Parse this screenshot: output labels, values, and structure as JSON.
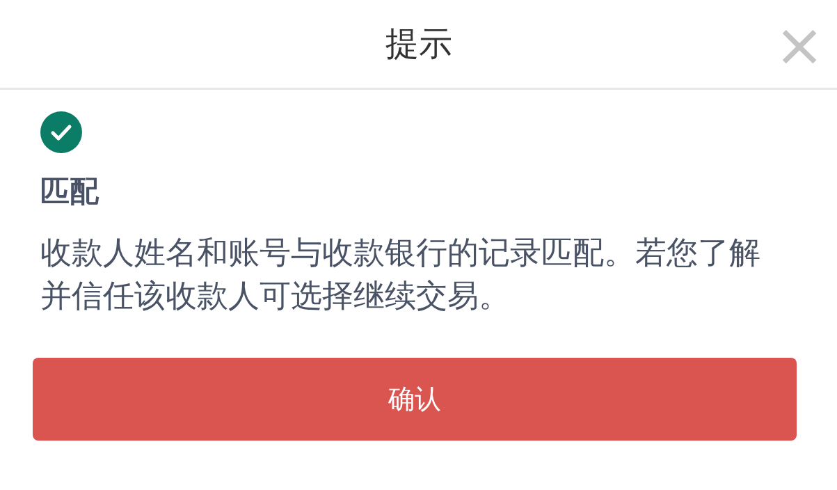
{
  "header": {
    "title": "提示",
    "close": "×"
  },
  "result": {
    "matched": true,
    "heading": "匹配",
    "message": "收款人姓名和账号与收款银行的记录匹配。若您了解并信任该收款人可选择继续交易。"
  },
  "buttons": [
    {
      "label": "确认",
      "kind": "primary"
    }
  ]
}
